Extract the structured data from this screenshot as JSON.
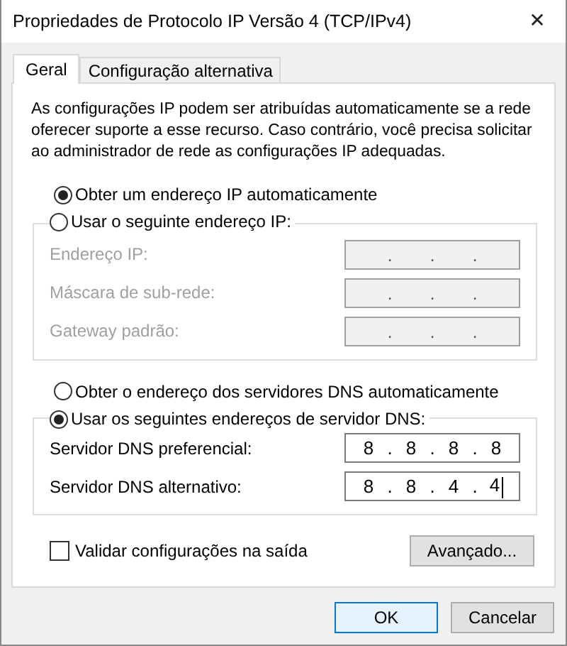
{
  "window": {
    "title": "Propriedades de Protocolo IP Versão 4 (TCP/IPv4)",
    "close": "✕"
  },
  "tabs": [
    {
      "label": "Geral",
      "selected": true
    },
    {
      "label": "Configuração alternativa",
      "selected": false
    }
  ],
  "description": "As configurações IP podem ser atribuídas automaticamente se a rede oferecer suporte a esse recurso. Caso contrário, você precisa solicitar ao administrador de rede as configurações IP adequadas.",
  "ip_separator": ".",
  "ip_mode": {
    "options": [
      {
        "label": "Obter um endereço IP automaticamente",
        "selected": true
      },
      {
        "label": "Usar o seguinte endereço IP:",
        "selected": false
      }
    ],
    "fields": [
      {
        "label": "Endereço IP:",
        "disabled": true
      },
      {
        "label": "Máscara de sub-rede:",
        "disabled": true
      },
      {
        "label": "Gateway padrão:",
        "disabled": true
      }
    ]
  },
  "dns_mode": {
    "options": [
      {
        "label": "Obter o endereço dos servidores DNS automaticamente",
        "selected": false
      },
      {
        "label": "Usar os seguintes endereços de servidor DNS:",
        "selected": true
      }
    ],
    "fields": [
      {
        "label": "Servidor DNS preferencial:",
        "disabled": false,
        "octets": [
          "8",
          "8",
          "8",
          "8"
        ],
        "focused": false
      },
      {
        "label": "Servidor DNS alternativo:",
        "disabled": false,
        "octets": [
          "8",
          "8",
          "4",
          "4"
        ],
        "focused": true
      }
    ]
  },
  "validate": {
    "label": "Validar configurações na saída",
    "checked": false
  },
  "advanced_button": "Avançado...",
  "buttons": [
    {
      "label": "OK",
      "default": true
    },
    {
      "label": "Cancelar",
      "default": false
    }
  ]
}
